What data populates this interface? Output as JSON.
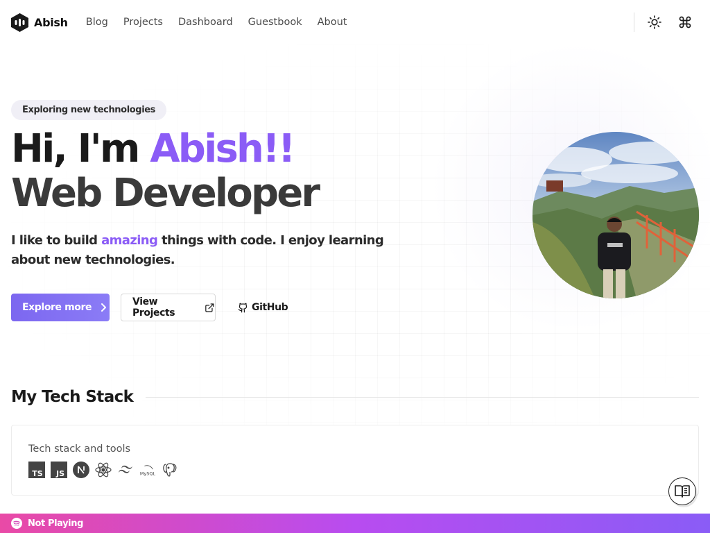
{
  "header": {
    "brand": "Abish",
    "nav": [
      "Blog",
      "Projects",
      "Dashboard",
      "Guestbook",
      "About"
    ],
    "icons": {
      "theme": "sun-icon",
      "command": "command-icon"
    }
  },
  "hero": {
    "badge": "Exploring new technologies",
    "greeting": "Hi, I'm ",
    "name": "Abish!!",
    "role": "Web Developer",
    "intro_before": "I like to build ",
    "intro_highlight": "amazing",
    "intro_after": " things with code. I enjoy learning about new technologies.",
    "buttons": {
      "explore": "Explore more",
      "projects": "View Projects",
      "github": "GitHub"
    }
  },
  "tech": {
    "title": "My Tech Stack",
    "card_label": "Tech stack and tools",
    "icons": [
      "typescript-icon",
      "javascript-icon",
      "nextjs-icon",
      "react-icon",
      "tailwind-icon",
      "mysql-icon",
      "postgresql-icon"
    ]
  },
  "player": {
    "status": "Not Playing"
  },
  "colors": {
    "accent": "#8b5cf6",
    "bar_start": "#e94aa6",
    "bar_end": "#8a5cf6"
  }
}
